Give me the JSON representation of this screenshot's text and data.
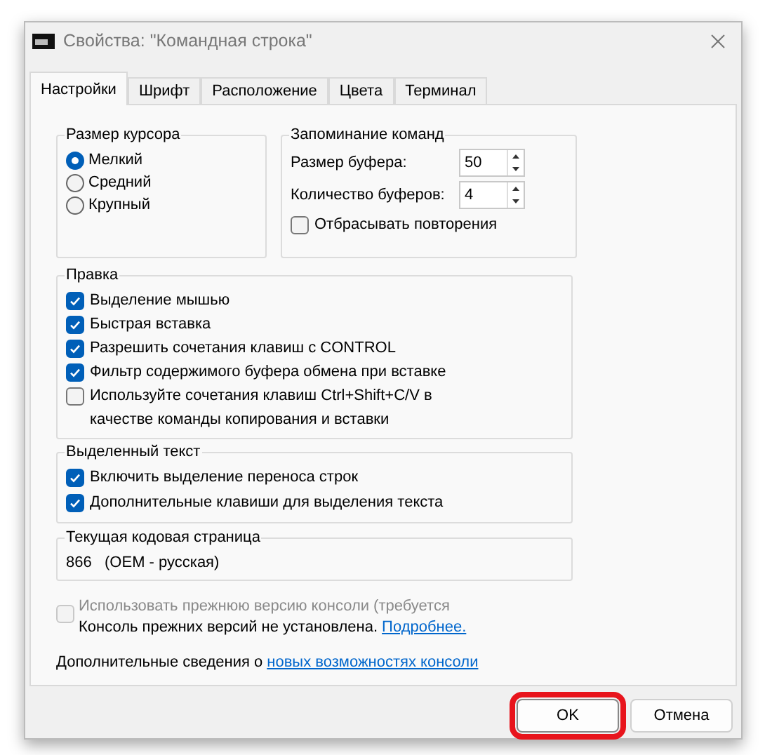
{
  "window": {
    "title": "Свойства: \"Командная строка\""
  },
  "tabs": [
    {
      "label": "Настройки",
      "selected": true
    },
    {
      "label": "Шрифт",
      "selected": false
    },
    {
      "label": "Расположение",
      "selected": false
    },
    {
      "label": "Цвета",
      "selected": false
    },
    {
      "label": "Терминал",
      "selected": false
    }
  ],
  "cursor_size": {
    "title": "Размер курсора",
    "options": [
      {
        "label": "Мелкий",
        "selected": true
      },
      {
        "label": "Средний",
        "selected": false
      },
      {
        "label": "Крупный",
        "selected": false
      }
    ]
  },
  "command_history": {
    "title": "Запоминание команд",
    "fields": [
      {
        "label": "Размер буфера:",
        "value": "50"
      },
      {
        "label": "Количество буферов:",
        "value": "4"
      }
    ],
    "discard": {
      "label": "Отбрасывать повторения",
      "checked": false
    }
  },
  "edit_options": {
    "title": "Правка",
    "items": [
      {
        "label": "Выделение мышью",
        "checked": true
      },
      {
        "label": "Быстрая вставка",
        "checked": true
      },
      {
        "label": "Разрешить сочетания клавиш с CONTROL",
        "checked": true
      },
      {
        "label": "Фильтр содержимого буфера обмена при вставке",
        "checked": true
      },
      {
        "label": "Используйте сочетания клавиш Ctrl+Shift+C/V в качестве команды копирования и вставки",
        "checked": false
      }
    ]
  },
  "selected_text": {
    "title": "Выделенный текст",
    "items": [
      {
        "label": "Включить выделение переноса строк",
        "checked": true
      },
      {
        "label": "Дополнительные клавиши для выделения текста",
        "checked": true
      }
    ]
  },
  "code_page": {
    "title": "Текущая кодовая страница",
    "value": "866   (OEM - русская)"
  },
  "legacy": {
    "label": "Использовать прежнюю версию консоли (требуется",
    "checked": false,
    "disabled": true,
    "note": "Консоль прежних версий не установлена.",
    "link": "Подробнее."
  },
  "info": {
    "text": "Дополнительные сведения о",
    "link": "новых возможностях консоли"
  },
  "buttons": [
    {
      "label": "OK",
      "highlighted": true
    },
    {
      "label": "Отмена",
      "highlighted": false
    }
  ]
}
